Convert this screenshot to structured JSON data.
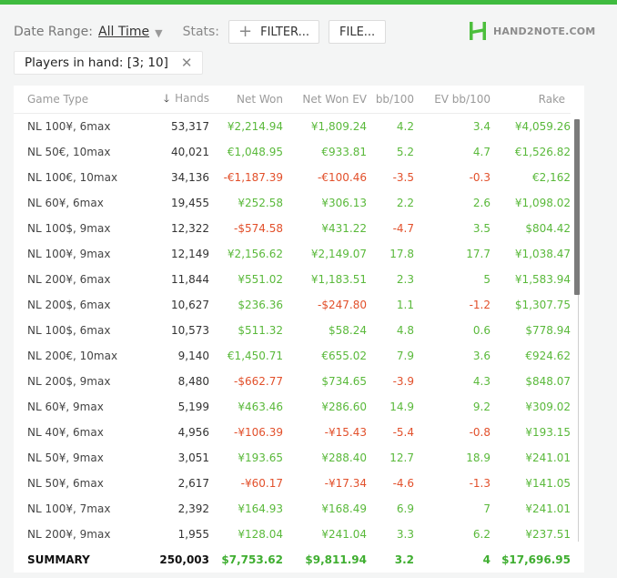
{
  "toolbar": {
    "date_range_label": "Date Range:",
    "date_range_value": "All Time",
    "stats_label": "Stats:",
    "filter_button": "FILTER...",
    "file_button": "FILE..."
  },
  "logo": {
    "text": "HAND2NOTE.COM",
    "mark": "H"
  },
  "filter_chip": {
    "label": "Players in hand: [3; 10]"
  },
  "colors": {
    "accent": "#3fbb3f",
    "positive": "#5ab93b",
    "negative": "#e2502b"
  },
  "icons": {
    "sort": "arrow-down-icon",
    "dropdown": "caret-down-icon",
    "add": "plus-icon",
    "close": "close-icon"
  },
  "table": {
    "columns": [
      "Game Type",
      "Hands",
      "Net Won",
      "Net Won  EV",
      "bb/100",
      "EV bb/100",
      "Rake"
    ],
    "sorted_column": "Hands",
    "rows": [
      {
        "game": "NL 100¥, 6max",
        "hands": "53,317",
        "net": "¥2,214.94",
        "net_ev": "¥1,809.24",
        "bb": "4.2",
        "ev_bb": "3.4",
        "rake": "¥4,059.26"
      },
      {
        "game": "NL 50€, 10max",
        "hands": "40,021",
        "net": "€1,048.95",
        "net_ev": "€933.81",
        "bb": "5.2",
        "ev_bb": "4.7",
        "rake": "€1,526.82"
      },
      {
        "game": "NL 100€, 10max",
        "hands": "34,136",
        "net": "-€1,187.39",
        "net_ev": "-€100.46",
        "bb": "-3.5",
        "ev_bb": "-0.3",
        "rake": "€2,162"
      },
      {
        "game": "NL 60¥, 6max",
        "hands": "19,455",
        "net": "¥252.58",
        "net_ev": "¥306.13",
        "bb": "2.2",
        "ev_bb": "2.6",
        "rake": "¥1,098.02"
      },
      {
        "game": "NL 100$, 9max",
        "hands": "12,322",
        "net": "-$574.58",
        "net_ev": "¥431.22",
        "bb": "-4.7",
        "ev_bb": "3.5",
        "rake": "$804.42"
      },
      {
        "game": "NL 100¥, 9max",
        "hands": "12,149",
        "net": "¥2,156.62",
        "net_ev": "¥2,149.07",
        "bb": "17.8",
        "ev_bb": "17.7",
        "rake": "¥1,038.47"
      },
      {
        "game": "NL 200¥, 6max",
        "hands": "11,844",
        "net": "¥551.02",
        "net_ev": "¥1,183.51",
        "bb": "2.3",
        "ev_bb": "5",
        "rake": "¥1,583.94"
      },
      {
        "game": "NL 200$, 6max",
        "hands": "10,627",
        "net": "$236.36",
        "net_ev": "-$247.80",
        "bb": "1.1",
        "ev_bb": "-1.2",
        "rake": "$1,307.75"
      },
      {
        "game": "NL 100$, 6max",
        "hands": "10,573",
        "net": "$511.32",
        "net_ev": "$58.24",
        "bb": "4.8",
        "ev_bb": "0.6",
        "rake": "$778.94"
      },
      {
        "game": "NL 200€, 10max",
        "hands": "9,140",
        "net": "€1,450.71",
        "net_ev": "€655.02",
        "bb": "7.9",
        "ev_bb": "3.6",
        "rake": "€924.62"
      },
      {
        "game": "NL 200$, 9max",
        "hands": "8,480",
        "net": "-$662.77",
        "net_ev": "$734.65",
        "bb": "-3.9",
        "ev_bb": "4.3",
        "rake": "$848.07"
      },
      {
        "game": "NL 60¥, 9max",
        "hands": "5,199",
        "net": "¥463.46",
        "net_ev": "¥286.60",
        "bb": "14.9",
        "ev_bb": "9.2",
        "rake": "¥309.02"
      },
      {
        "game": "NL 40¥, 6max",
        "hands": "4,956",
        "net": "-¥106.39",
        "net_ev": "-¥15.43",
        "bb": "-5.4",
        "ev_bb": "-0.8",
        "rake": "¥193.15"
      },
      {
        "game": "NL 50¥, 9max",
        "hands": "3,051",
        "net": "¥193.65",
        "net_ev": "¥288.40",
        "bb": "12.7",
        "ev_bb": "18.9",
        "rake": "¥241.01"
      },
      {
        "game": "NL 50¥, 6max",
        "hands": "2,617",
        "net": "-¥60.17",
        "net_ev": "-¥17.34",
        "bb": "-4.6",
        "ev_bb": "-1.3",
        "rake": "¥141.05"
      },
      {
        "game": "NL 100¥, 7max",
        "hands": "2,392",
        "net": "¥164.93",
        "net_ev": "¥168.49",
        "bb": "6.9",
        "ev_bb": "7",
        "rake": "¥241.01"
      },
      {
        "game": "NL 200¥, 9max",
        "hands": "1,955",
        "net": "¥128.04",
        "net_ev": "¥241.04",
        "bb": "3.3",
        "ev_bb": "6.2",
        "rake": "¥237.51"
      }
    ],
    "summary": {
      "game": "SUMMARY",
      "hands": "250,003",
      "net": "$7,753.62",
      "net_ev": "$9,811.94",
      "bb": "3.2",
      "ev_bb": "4",
      "rake": "$17,696.95"
    }
  },
  "scrollbar": {
    "visible_fraction": 0.41
  }
}
